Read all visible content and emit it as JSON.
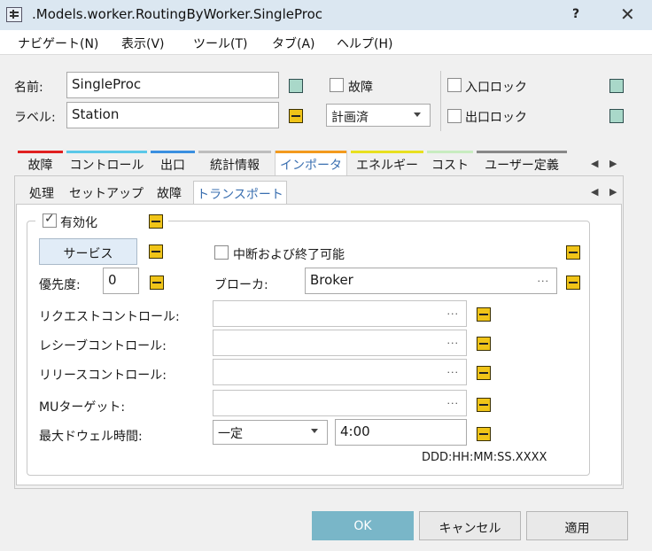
{
  "window": {
    "title": ".Models.worker.RoutingByWorker.SingleProc",
    "help": "?",
    "close": "✕"
  },
  "menu": [
    "ナビゲート(N)",
    "表示(V)",
    "ツール(T)",
    "タブ(A)",
    "ヘルプ(H)"
  ],
  "header": {
    "name_label": "名前:",
    "name_value": "SingleProc",
    "label_label": "ラベル:",
    "label_value": "Station",
    "failure_label": "故障",
    "plan_value": "計画済",
    "entrance_lock_label": "入口ロック",
    "exit_lock_label": "出口ロック"
  },
  "tabs": [
    {
      "label": "故障",
      "color": "#e02020"
    },
    {
      "label": "コントロール",
      "color": "#5bc8e8"
    },
    {
      "label": "出口",
      "color": "#3a8fe0"
    },
    {
      "label": "統計情報",
      "color": "#bdbdbd"
    },
    {
      "label": "インポータ",
      "color": "#f39a1e"
    },
    {
      "label": "エネルギー",
      "color": "#e8e020"
    },
    {
      "label": "コスト",
      "color": "#c8ecc0"
    },
    {
      "label": "ユーザー定義",
      "color": "#888888"
    }
  ],
  "subtabs": [
    "処理",
    "セットアップ",
    "故障",
    "トランスポート"
  ],
  "transport": {
    "enabled_label": "有効化",
    "service_button": "サービス",
    "interrupt_label": "中断および終了可能",
    "priority_label": "優先度:",
    "priority_value": "0",
    "broker_label": "ブローカ:",
    "broker_value": "Broker",
    "request_control_label": "リクエストコントロール:",
    "receive_control_label": "レシーブコントロール:",
    "release_control_label": "リリースコントロール:",
    "mu_target_label": "MUターゲット:",
    "max_dwell_label": "最大ドウェル時間:",
    "max_dwell_mode": "一定",
    "max_dwell_value": "4:00",
    "time_format": "DDD:HH:MM:SS.XXXX",
    "browse": "..."
  },
  "buttons": {
    "ok": "OK",
    "cancel": "キャンセル",
    "apply": "適用"
  }
}
